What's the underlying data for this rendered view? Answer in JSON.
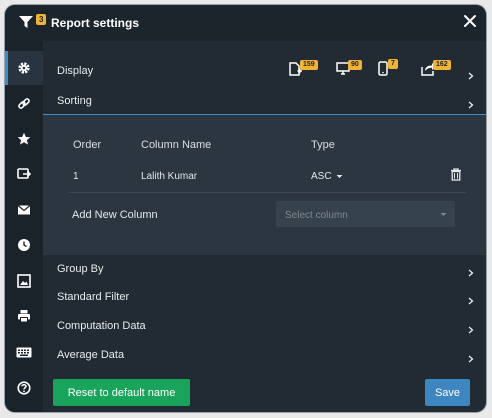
{
  "window": {
    "title": "Report settings",
    "filter_badge": "3"
  },
  "sidebar": {
    "items": [
      {
        "icon": "gear-icon",
        "active": true
      },
      {
        "icon": "link-icon"
      },
      {
        "icon": "star-icon"
      },
      {
        "icon": "export-icon"
      },
      {
        "icon": "mail-icon"
      },
      {
        "icon": "clock-icon"
      },
      {
        "icon": "image-icon"
      },
      {
        "icon": "print-icon"
      },
      {
        "icon": "keyboard-icon"
      },
      {
        "icon": "help-icon"
      }
    ]
  },
  "sections": {
    "display": "Display",
    "sorting": "Sorting",
    "group_by": "Group By",
    "standard_filter": "Standard Filter",
    "computation_data": "Computation Data",
    "average_data": "Average Data"
  },
  "stats": {
    "add": "159",
    "monitor": "90",
    "mobile": "7",
    "share": "162"
  },
  "sorting": {
    "headers": {
      "order": "Order",
      "column_name": "Column Name",
      "type": "Type"
    },
    "rows": [
      {
        "order": "1",
        "column_name": "Lalith Kumar",
        "type": "ASC"
      }
    ],
    "add_new_column": "Add New Column",
    "select_placeholder": "Select column"
  },
  "footer": {
    "reset_label": "Reset to default name",
    "save_label": "Save"
  },
  "colors": {
    "background": "#222b33",
    "accent_blue": "#3d86bf",
    "green": "#18a55b",
    "badge": "#f2b233"
  }
}
